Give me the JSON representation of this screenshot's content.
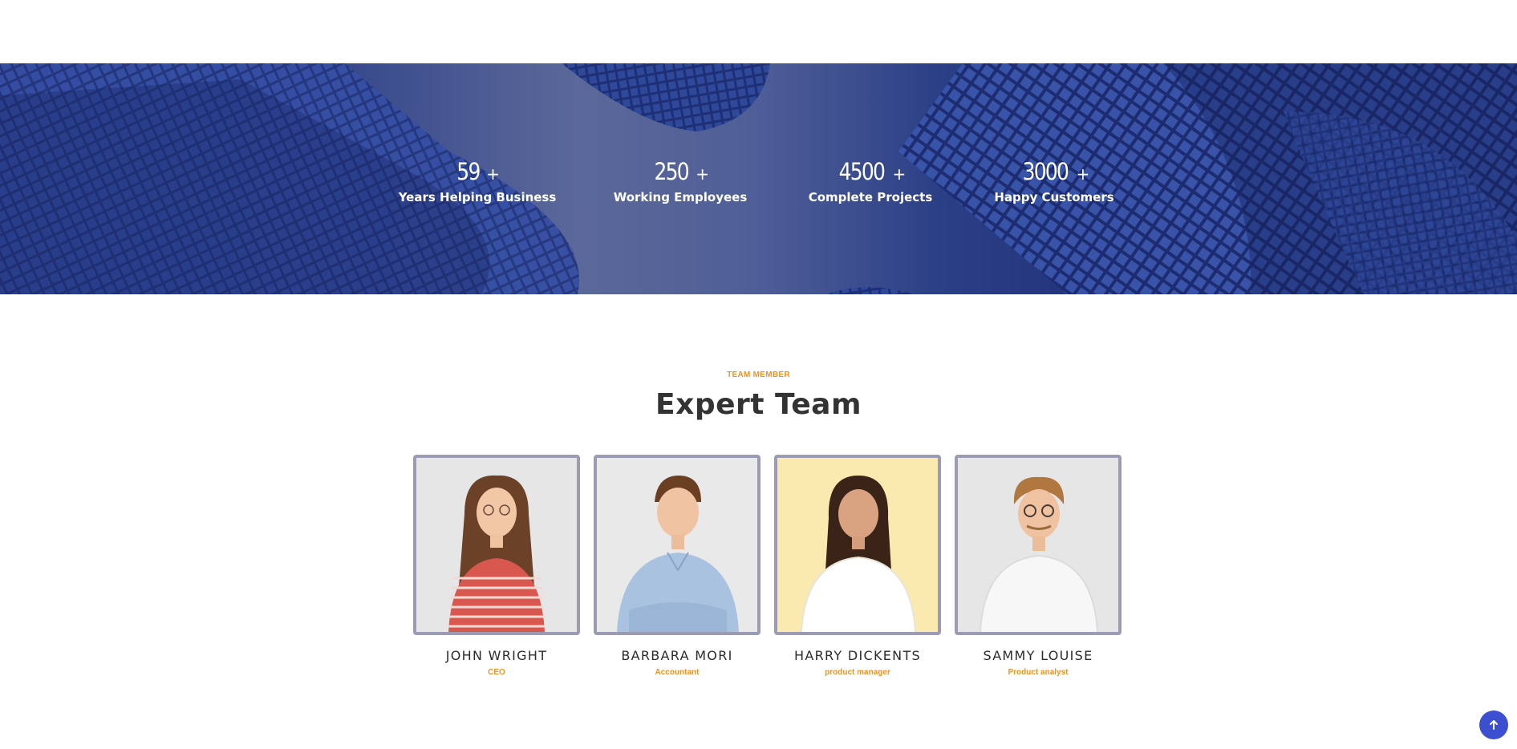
{
  "stats": [
    {
      "number": "59",
      "suffix": "+",
      "label": "Years Helping Business"
    },
    {
      "number": "250",
      "suffix": "+",
      "label": "Working Employees"
    },
    {
      "number": "4500",
      "suffix": "+",
      "label": "Complete Projects"
    },
    {
      "number": "3000",
      "suffix": "+",
      "label": "Happy Customers"
    }
  ],
  "team": {
    "eyebrow": "TEAM MEMBER",
    "title": "Expert Team",
    "members": [
      {
        "name": "JOHN WRIGHT",
        "role": "CEO"
      },
      {
        "name": "BARBARA MORI",
        "role": "Accountant"
      },
      {
        "name": "HARRY DICKENTS",
        "role": "product manager"
      },
      {
        "name": "SAMMY LOUISE",
        "role": "Product analyst"
      }
    ]
  },
  "scroll_top": {
    "icon": "arrow-up-icon"
  },
  "colors": {
    "accent": "#f2911b",
    "banner": "#2b3f86",
    "button": "#3b4fd0",
    "frame": "#9b9bb4"
  }
}
